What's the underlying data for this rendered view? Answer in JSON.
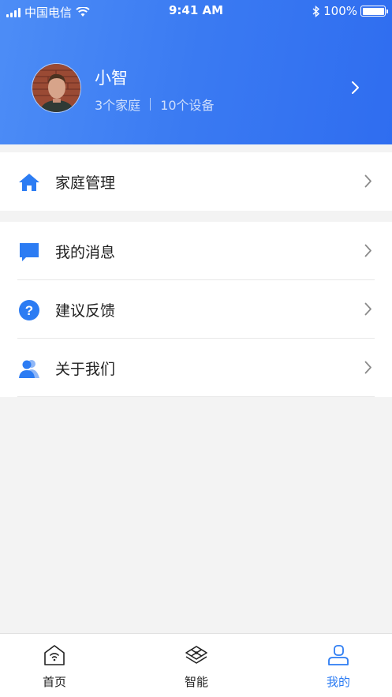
{
  "status_bar": {
    "carrier": "中国电信",
    "time": "9:41 AM",
    "battery": "100%"
  },
  "profile": {
    "name": "小智",
    "families": "3个家庭",
    "devices": "10个设备"
  },
  "menu": {
    "group1": [
      {
        "label": "家庭管理",
        "icon": "home-icon"
      }
    ],
    "group2": [
      {
        "label": "我的消息",
        "icon": "message-icon"
      },
      {
        "label": "建议反馈",
        "icon": "question-icon"
      },
      {
        "label": "关于我们",
        "icon": "users-icon"
      }
    ]
  },
  "tabbar": {
    "home": "首页",
    "smart": "智能",
    "mine": "我的"
  },
  "colors": {
    "accent": "#2c7cf3",
    "header_start": "#4d8df6",
    "header_end": "#2f6df0"
  }
}
